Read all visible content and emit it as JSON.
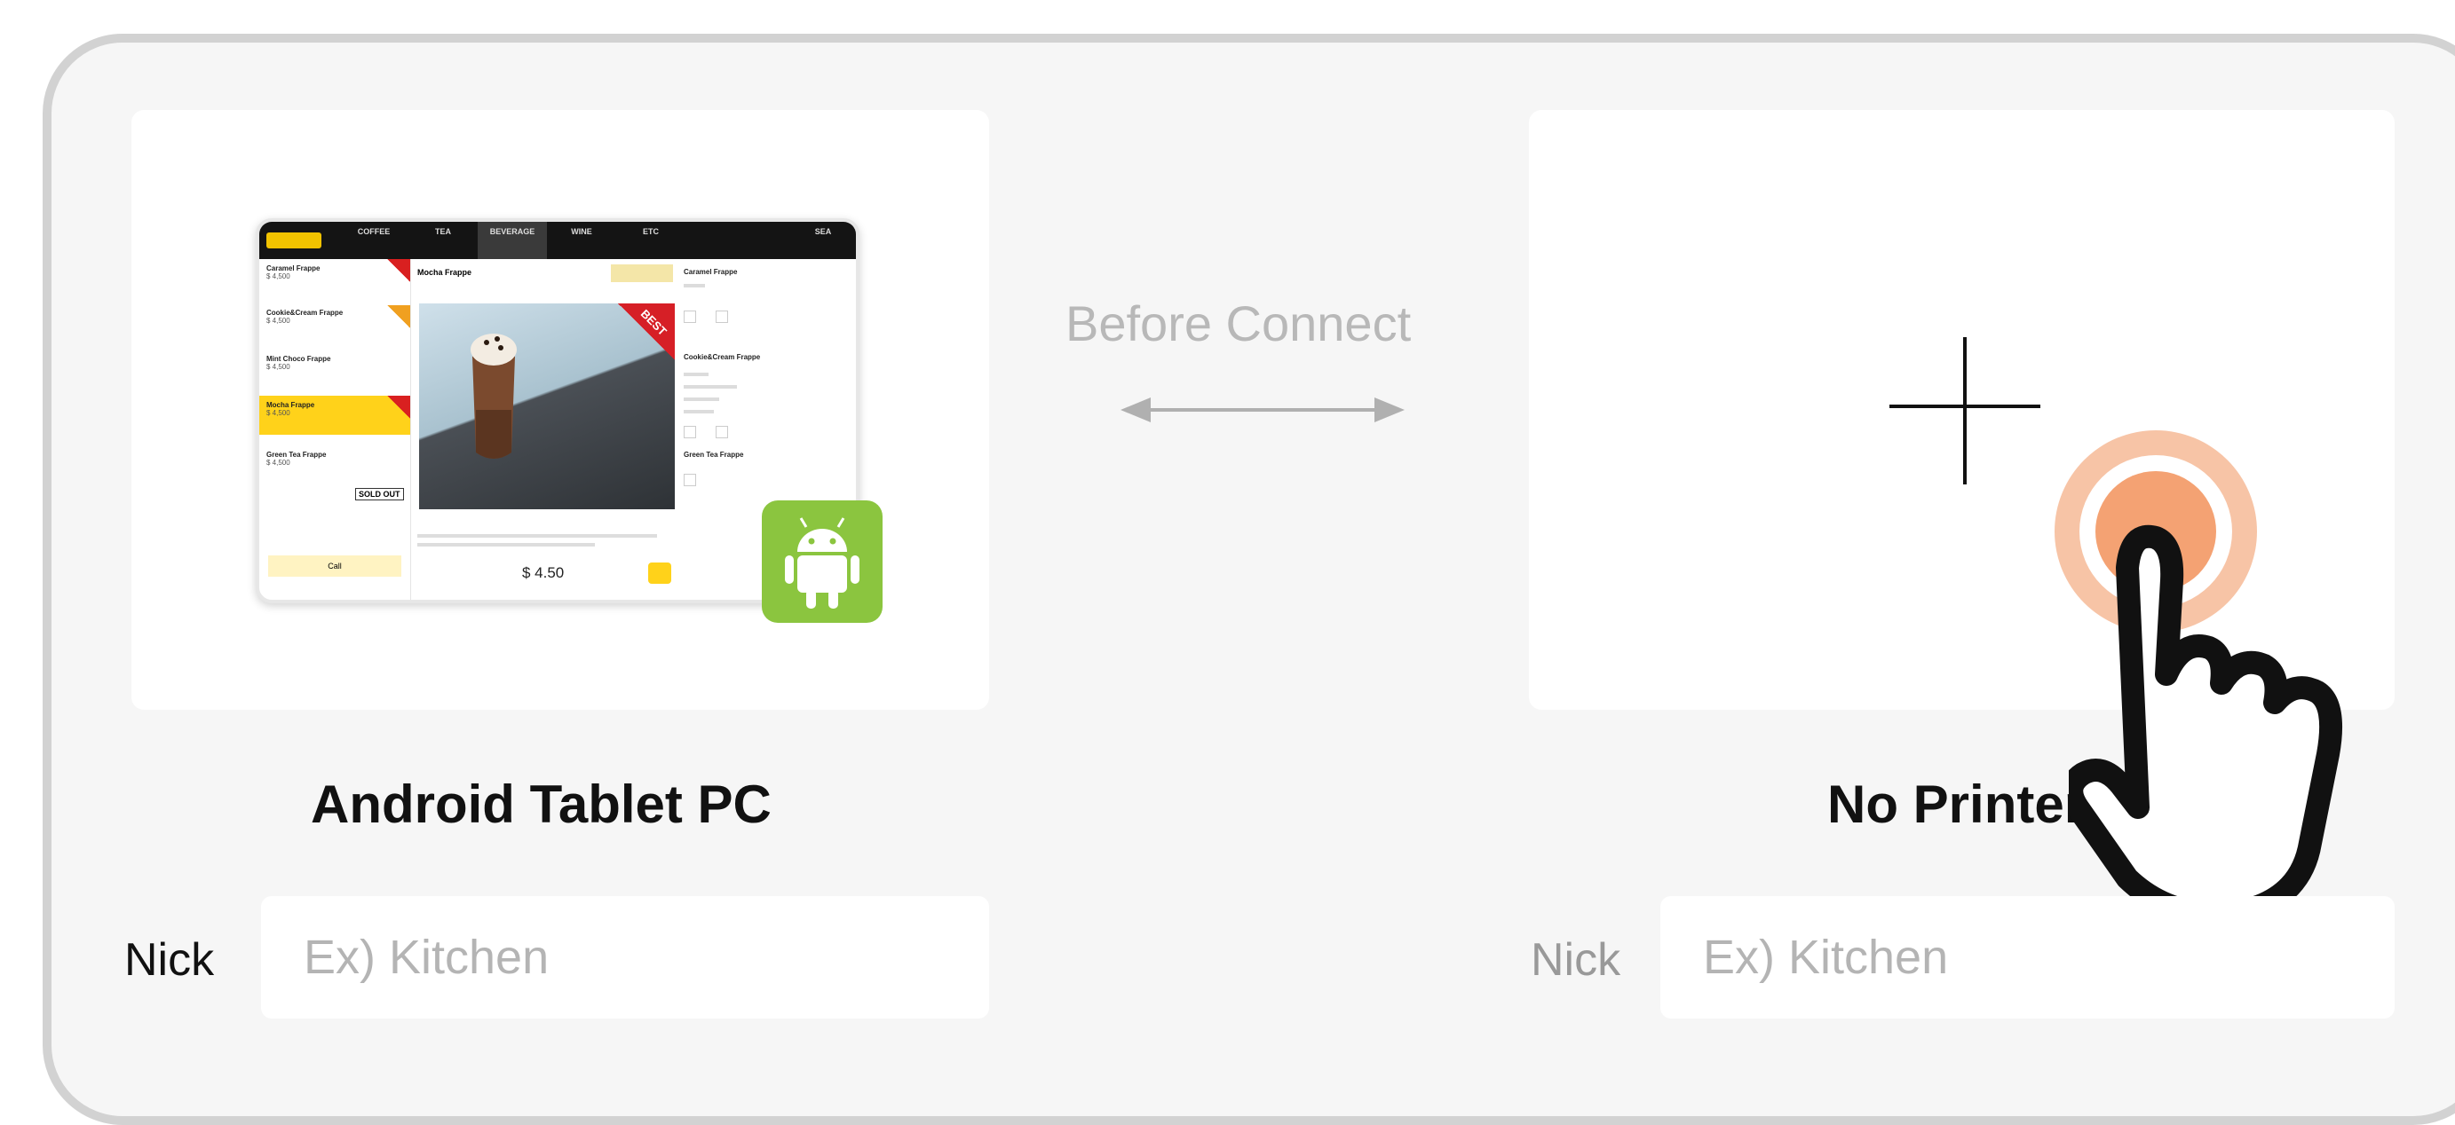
{
  "left_device": {
    "title": "Android Tablet PC",
    "nick_label": "Nick",
    "nick_placeholder": "Ex) Kitchen",
    "badge_icon": "android-icon",
    "badge_color": "#8bc53f"
  },
  "connection": {
    "status": "Before Connect",
    "arrow_icon": "double-arrow-icon"
  },
  "right_device": {
    "title": "No Printer",
    "nick_label": "Nick",
    "nick_placeholder": "Ex) Kitchen",
    "add_icon": "plus-icon",
    "pointer_icon": "hand-pointer-icon",
    "highlight_color": "#f4a273"
  },
  "tablet_screen": {
    "tabs": [
      "COFFEE",
      "TEA",
      "BEVERAGE",
      "WINE",
      "ETC",
      "SEA"
    ],
    "menu_items": [
      {
        "name": "Caramel Frappe",
        "price": "$ 4,500"
      },
      {
        "name": "Cookie&Cream Frappe",
        "price": "$ 4,500"
      },
      {
        "name": "Mint Choco Frappe",
        "price": "$ 4,500"
      },
      {
        "name": "Mocha Frappe",
        "price": "$ 4,500"
      },
      {
        "name": "Green Tea Frappe",
        "price": "$ 4,500"
      }
    ],
    "sold_out": "SOLD OUT",
    "call_label": "Call",
    "detail_title": "Mocha Frappe",
    "best_badge": "BEST",
    "price": "$ 4.50",
    "cart_items": [
      "Caramel Frappe",
      "Cookie&Cream Frappe",
      "Green Tea Frappe"
    ]
  }
}
